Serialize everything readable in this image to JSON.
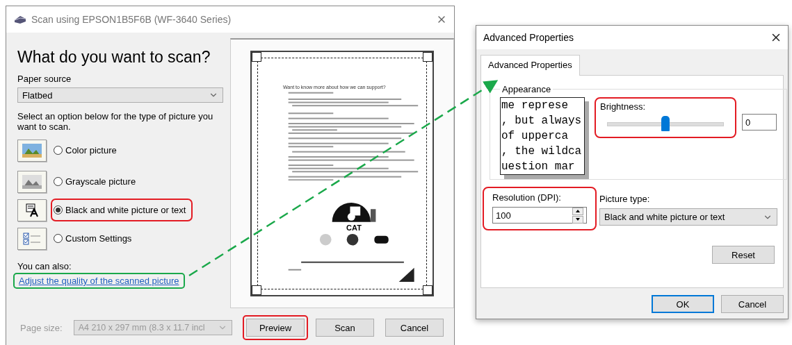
{
  "scan_dialog": {
    "title": "Scan using EPSON1B5F6B (WF-3640 Series)",
    "heading": "What do you want to scan?",
    "paper_source": {
      "label": "Paper source",
      "value": "Flatbed"
    },
    "instruction": "Select an option below for the type of picture you want to scan.",
    "picture_types": [
      {
        "label": "Color picture",
        "kind": "color",
        "selected": false
      },
      {
        "label": "Grayscale picture",
        "kind": "grayscale",
        "selected": false
      },
      {
        "label": "Black and white picture or text",
        "kind": "bw",
        "selected": true,
        "color": "#e31b23"
      },
      {
        "label": "Custom Settings",
        "kind": "custom",
        "selected": false
      }
    ],
    "also_label": "You can also:",
    "link": {
      "text": "Adjust the quality of the scanned picture",
      "color": "#1aa84a"
    },
    "page_size": {
      "label": "Page size:",
      "value": "A4 210 x 297 mm (8.3 x 11.7 incl",
      "disabled": true
    },
    "preview": {
      "heading": "Want to know more about how we can support?",
      "logo_label": "CAT"
    },
    "buttons": [
      {
        "label": "Preview",
        "color": "#e31b23"
      },
      {
        "label": "Scan"
      },
      {
        "label": "Cancel"
      }
    ]
  },
  "callout_arrow": true,
  "advanced_dialog": {
    "title": "Advanced Properties",
    "tabs": [
      {
        "label": "Advanced Properties",
        "selected": true
      }
    ],
    "group_label": "Appearance",
    "sample_lines": [
      "me represe",
      ", but always",
      "of upperca",
      ", the wildca",
      "uestion mar"
    ],
    "brightness": {
      "label": "Brightness:",
      "level": 0.5,
      "value": "0",
      "color": "#e31b23"
    },
    "resolution": {
      "label": "Resolution (DPI):",
      "value": "100",
      "color": "#e31b23"
    },
    "picture_type": {
      "label": "Picture type:",
      "value": "Black and white picture or text"
    },
    "reset_button": "Reset",
    "buttons": [
      {
        "label": "OK",
        "default": true
      },
      {
        "label": "Cancel",
        "default": false
      }
    ]
  }
}
